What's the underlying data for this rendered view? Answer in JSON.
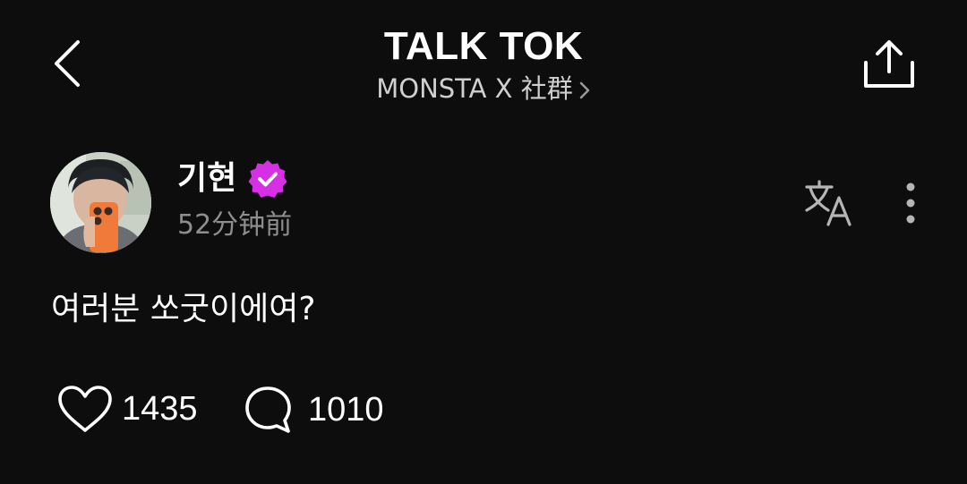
{
  "header": {
    "title": "TALK TOK",
    "community": "MONSTA X 社群",
    "back_icon": "chevron-left-icon",
    "share_icon": "share-icon"
  },
  "post": {
    "author": "기현",
    "verified_icon": "verified-badge-icon",
    "time": "52分钟前",
    "body": "여러분 쏘굿이에여?",
    "translate_icon": "translate-icon",
    "more_icon": "more-vertical-icon",
    "likes": "1435",
    "comments": "1010"
  },
  "colors": {
    "background": "#0d0d0d",
    "text": "#ffffff",
    "muted": "#8e8e8e",
    "verified": "#d62fe6"
  }
}
